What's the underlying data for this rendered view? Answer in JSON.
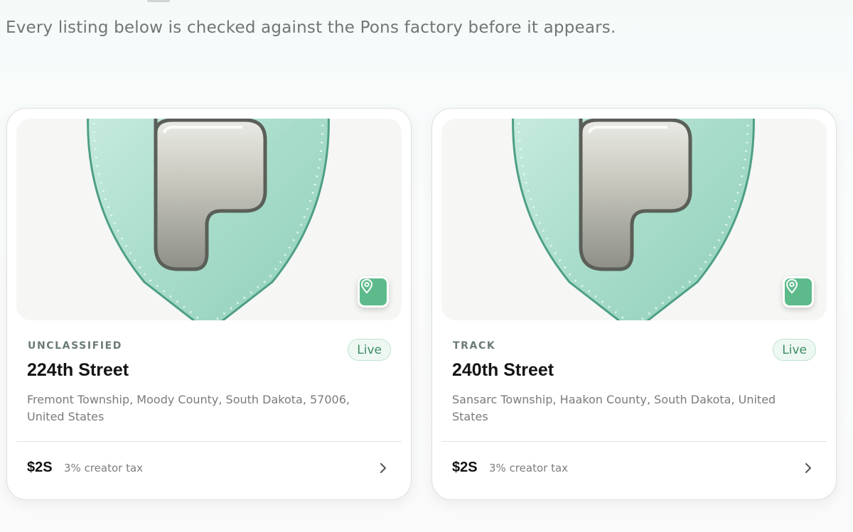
{
  "subtitle": "Every listing below is checked against the Pons factory before it appears.",
  "listings": [
    {
      "category": "UNCLASSIFIED",
      "status": "Live",
      "street": "224th Street",
      "address": "Fremont Township, Moody County, South Dakota, 57006, United States",
      "price": "$2S",
      "tax": "3% creator tax",
      "icon": "map-pin-icon"
    },
    {
      "category": "TRACK",
      "status": "Live",
      "street": "240th Street",
      "address": "Sansarc Township, Haakon County, South Dakota, United States",
      "price": "$2S",
      "tax": "3% creator tax",
      "icon": "map-pin-icon"
    }
  ],
  "colors": {
    "accent_green": "#5dbb8b",
    "pin_mint": "#a8dcca",
    "live_text": "#3d8b63"
  }
}
